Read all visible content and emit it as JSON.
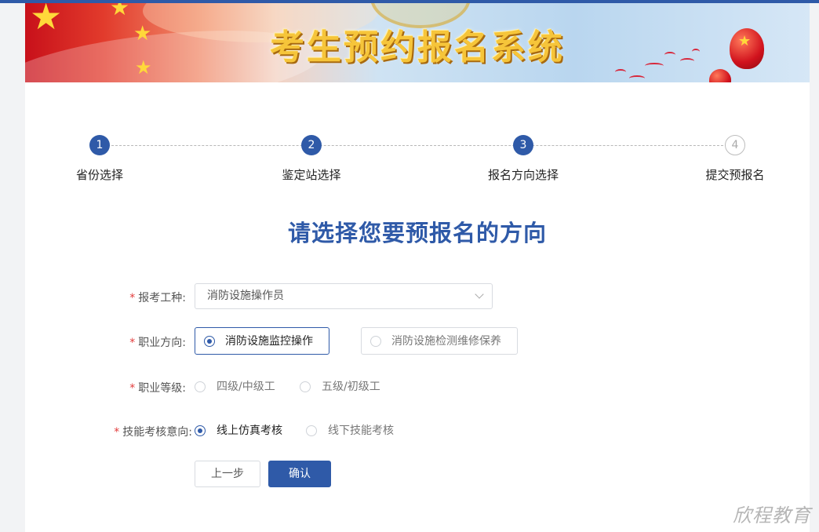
{
  "banner": {
    "title": "考生预约报名系统"
  },
  "steps": [
    {
      "number": "1",
      "label": "省份选择",
      "status": "done"
    },
    {
      "number": "2",
      "label": "鉴定站选择",
      "status": "done"
    },
    {
      "number": "3",
      "label": "报名方向选择",
      "status": "current"
    },
    {
      "number": "4",
      "label": "提交预报名",
      "status": "pending"
    }
  ],
  "main": {
    "title": "请选择您要预报名的方向"
  },
  "form": {
    "required_mark": "*",
    "job_type": {
      "label": "报考工种:",
      "value": "消防设施操作员"
    },
    "career_direction": {
      "label": "职业方向:",
      "options": [
        "消防设施监控操作",
        "消防设施检测维修保养"
      ],
      "selected": "消防设施监控操作"
    },
    "career_level": {
      "label": "职业等级:",
      "options": [
        "四级/中级工",
        "五级/初级工"
      ],
      "selected": null
    },
    "skill_assessment": {
      "label": "技能考核意向:",
      "options": [
        "线上仿真考核",
        "线下技能考核"
      ],
      "selected": "线上仿真考核"
    },
    "buttons": {
      "back": "上一步",
      "confirm": "确认"
    }
  },
  "watermark": "欣程教育",
  "colors": {
    "primary": "#2f5aa8",
    "required": "#e23b3b",
    "border": "#d8dbe0"
  }
}
